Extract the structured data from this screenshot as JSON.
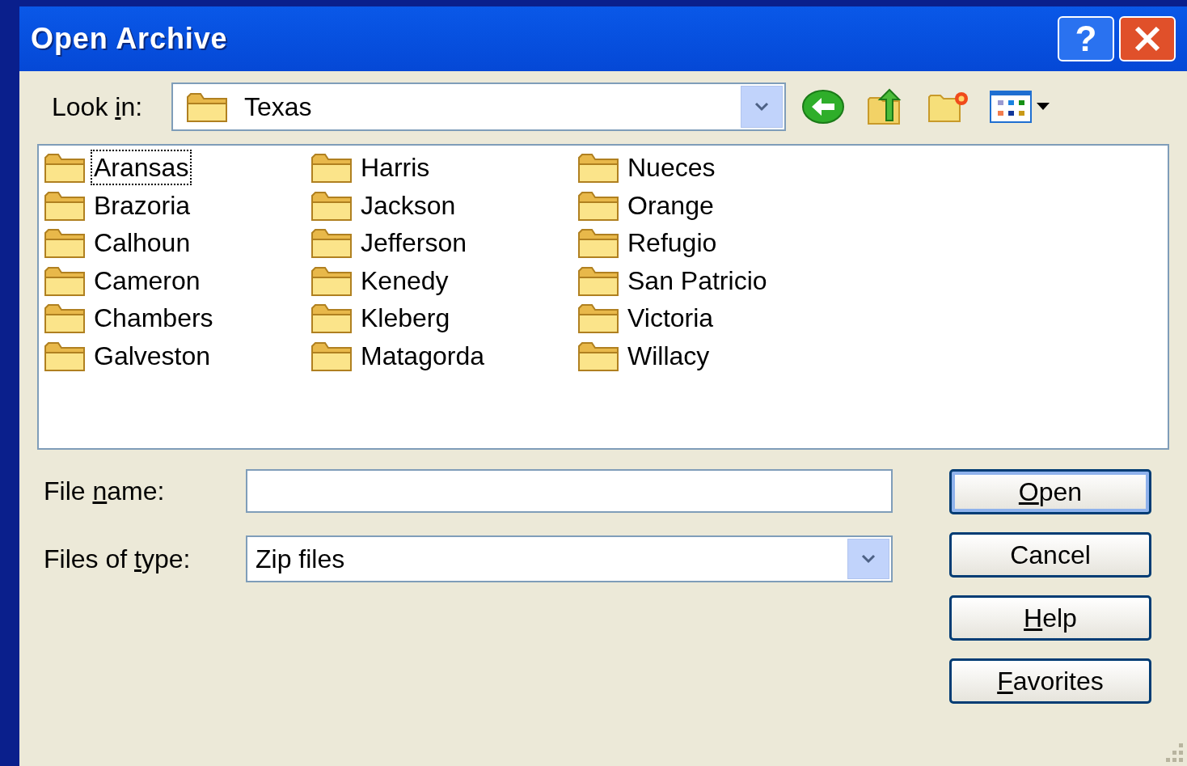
{
  "window": {
    "title": "Open Archive",
    "buttons": [
      {
        "kind": "help",
        "label": "?"
      },
      {
        "kind": "close"
      }
    ]
  },
  "look_in": {
    "label": {
      "pre": "Look ",
      "key": "i",
      "post": "n:"
    },
    "value": "Texas"
  },
  "toolbar": [
    {
      "kind": "back"
    },
    {
      "kind": "up"
    },
    {
      "kind": "new-folder"
    },
    {
      "kind": "view"
    }
  ],
  "folders": [
    [
      {
        "name": "Aransas",
        "selected": true
      },
      {
        "name": "Brazoria",
        "selected": false
      },
      {
        "name": "Calhoun",
        "selected": false
      },
      {
        "name": "Cameron",
        "selected": false
      },
      {
        "name": "Chambers",
        "selected": false
      },
      {
        "name": "Galveston",
        "selected": false
      }
    ],
    [
      {
        "name": "Harris",
        "selected": false
      },
      {
        "name": "Jackson",
        "selected": false
      },
      {
        "name": "Jefferson",
        "selected": false
      },
      {
        "name": "Kenedy",
        "selected": false
      },
      {
        "name": "Kleberg",
        "selected": false
      },
      {
        "name": "Matagorda",
        "selected": false
      }
    ],
    [
      {
        "name": "Nueces",
        "selected": false
      },
      {
        "name": "Orange",
        "selected": false
      },
      {
        "name": "Refugio",
        "selected": false
      },
      {
        "name": "San Patricio",
        "selected": false
      },
      {
        "name": "Victoria",
        "selected": false
      },
      {
        "name": "Willacy",
        "selected": false
      }
    ]
  ],
  "file_name": {
    "label": {
      "pre": "File ",
      "key": "n",
      "post": "ame:"
    }
  },
  "file_type": {
    "label": {
      "pre": "Files of ",
      "key": "t",
      "post": "ype:"
    },
    "value": "Zip files"
  },
  "buttons": [
    {
      "label": {
        "key": "O",
        "post": "pen"
      },
      "default": true
    },
    {
      "label": {
        "pre": "Cancel"
      },
      "default": false
    },
    {
      "label": {
        "key": "H",
        "post": "elp"
      },
      "default": false
    },
    {
      "label": {
        "key": "F",
        "post": "avorites"
      },
      "default": false
    }
  ]
}
